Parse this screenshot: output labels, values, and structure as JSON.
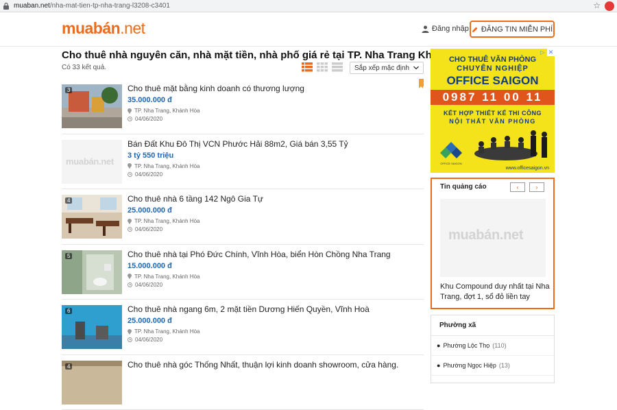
{
  "browser": {
    "url_domain": "muaban.net",
    "url_path": "/nha-mat-tien-tp-nha-trang-l3208-c3401"
  },
  "header": {
    "logo_main": "muabán",
    "logo_suffix": ".net",
    "login_label": "Đăng nhập",
    "post_label": "ĐĂNG TIN MIỄN PHÍ"
  },
  "main": {
    "title": "Cho thuê nhà nguyên căn, nhà mặt tiền, nhà phố giá rẻ tại TP. Nha Trang Khánh Hòa",
    "result_count": "Có 33 kết quả.",
    "sort_label": "Sắp xếp mặc định",
    "listings": [
      {
        "badge": "3",
        "title": "Cho thuê mặt bằng kinh doanh có thương lượng",
        "price": "35.000.000 đ",
        "location": "TP. Nha Trang, Khánh Hòa",
        "date": "04/06/2020"
      },
      {
        "badge": "",
        "title": "Bán Đất Khu Đô Thị VCN Phước Hải 88m2, Giá bán 3,55 Tỷ",
        "price": "3 tỷ 550 triệu",
        "location": "TP. Nha Trang, Khánh Hòa",
        "date": "04/06/2020"
      },
      {
        "badge": "4",
        "title": "Cho thuê nhà 6 tầng 142 Ngô Gia Tự",
        "price": "25.000.000 đ",
        "location": "TP. Nha Trang, Khánh Hòa",
        "date": "04/06/2020"
      },
      {
        "badge": "5",
        "title": "Cho thuê nhà tại Phó Đức Chính, Vĩnh Hòa, biển Hòn Chồng Nha Trang",
        "price": "15.000.000 đ",
        "location": "TP. Nha Trang, Khánh Hòa",
        "date": "04/06/2020"
      },
      {
        "badge": "6",
        "title": "Cho thuê nhà ngang 6m, 2 mặt tiền Dương Hiến Quyền, Vĩnh Hoà",
        "price": "25.000.000 đ",
        "location": "TP. Nha Trang, Khánh Hòa",
        "date": "04/06/2020"
      },
      {
        "badge": "4",
        "title": "Cho thuê nhà góc Thống Nhất, thuận lợi kinh doanh showroom, cửa hàng.",
        "price": "",
        "location": "",
        "date": ""
      }
    ],
    "placeholder_logo": "muabán.net"
  },
  "ad": {
    "line1": "CHO THUÊ VĂN PHÒNG",
    "line2": "CHUYÊN NGHIỆP",
    "brand": "OFFICE SAIGON",
    "phone": "0987 11 00 11",
    "line3": "KẾT HỢP THIẾT KẾ THI CÔNG",
    "line4": "NỘI THẤT VĂN PHÒNG",
    "logo_text": "OFFICE SAIGON",
    "website": "www.officesaigon.vn",
    "bg_color": "#f4e21a",
    "accent_color": "#e0551b"
  },
  "promo": {
    "heading": "Tin quảng cáo",
    "placeholder_logo": "muabán.net",
    "caption": "Khu Compound duy nhất tại Nha Trang, đợt 1, sổ đỏ liền tay"
  },
  "wards": {
    "heading": "Phường xã",
    "items": [
      {
        "name": "Phường Lộc Thọ",
        "count": "(110)"
      },
      {
        "name": "Phường Ngọc Hiệp",
        "count": "(13)"
      }
    ]
  },
  "colors": {
    "brand_orange": "#ee6b19",
    "price_blue": "#1e65b4"
  }
}
